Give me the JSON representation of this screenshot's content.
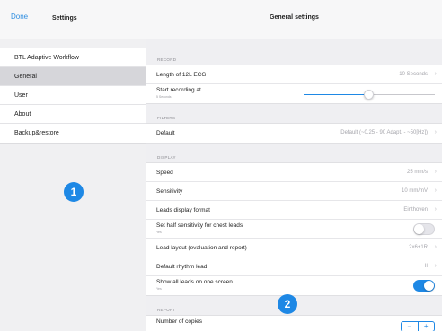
{
  "left": {
    "done_label": "Done",
    "title": "Settings",
    "items": [
      {
        "label": "BTL Adaptive Workflow",
        "selected": false
      },
      {
        "label": "General",
        "selected": true
      },
      {
        "label": "User",
        "selected": false
      },
      {
        "label": "About",
        "selected": false
      },
      {
        "label": "Backup&restore",
        "selected": false
      }
    ]
  },
  "right": {
    "title": "General settings",
    "record": {
      "header": "RECORD",
      "length_label": "Length of 12L ECG",
      "length_value": "10 Seconds",
      "start_label": "Start recording at",
      "start_sub": "5 Seconds",
      "start_fraction": 0.5
    },
    "filters": {
      "header": "FILTERS",
      "default_label": "Default",
      "default_value": "Default (~0.25 - 90 Adapt. - ~50[Hz])"
    },
    "display": {
      "header": "DISPLAY",
      "speed_label": "Speed",
      "speed_value": "25 mm/s",
      "sensitivity_label": "Sensitivity",
      "sensitivity_value": "10 mm/mV",
      "leads_format_label": "Leads display format",
      "leads_format_value": "Einthoven",
      "half_sens_label": "Set half sensitivity for chest leads",
      "half_sens_sub": "Yes",
      "half_sens_on": false,
      "lead_layout_label": "Lead layout (evaluation and report)",
      "lead_layout_value": "2x6+1R",
      "rhythm_label": "Default rhythm lead",
      "rhythm_value": "II",
      "all_leads_label": "Show all leads on one screen",
      "all_leads_sub": "Yes",
      "all_leads_on": true
    },
    "report": {
      "header": "REPORT",
      "copies_label": "Number of copies",
      "minus": "−",
      "plus": "+"
    }
  },
  "badges": {
    "one": "1",
    "two": "2"
  },
  "colors": {
    "accent": "#1e88e5",
    "selected_row": "#d6d6da",
    "background": "#efeff2"
  },
  "icons": {
    "chevron": "chevron-right-icon"
  }
}
